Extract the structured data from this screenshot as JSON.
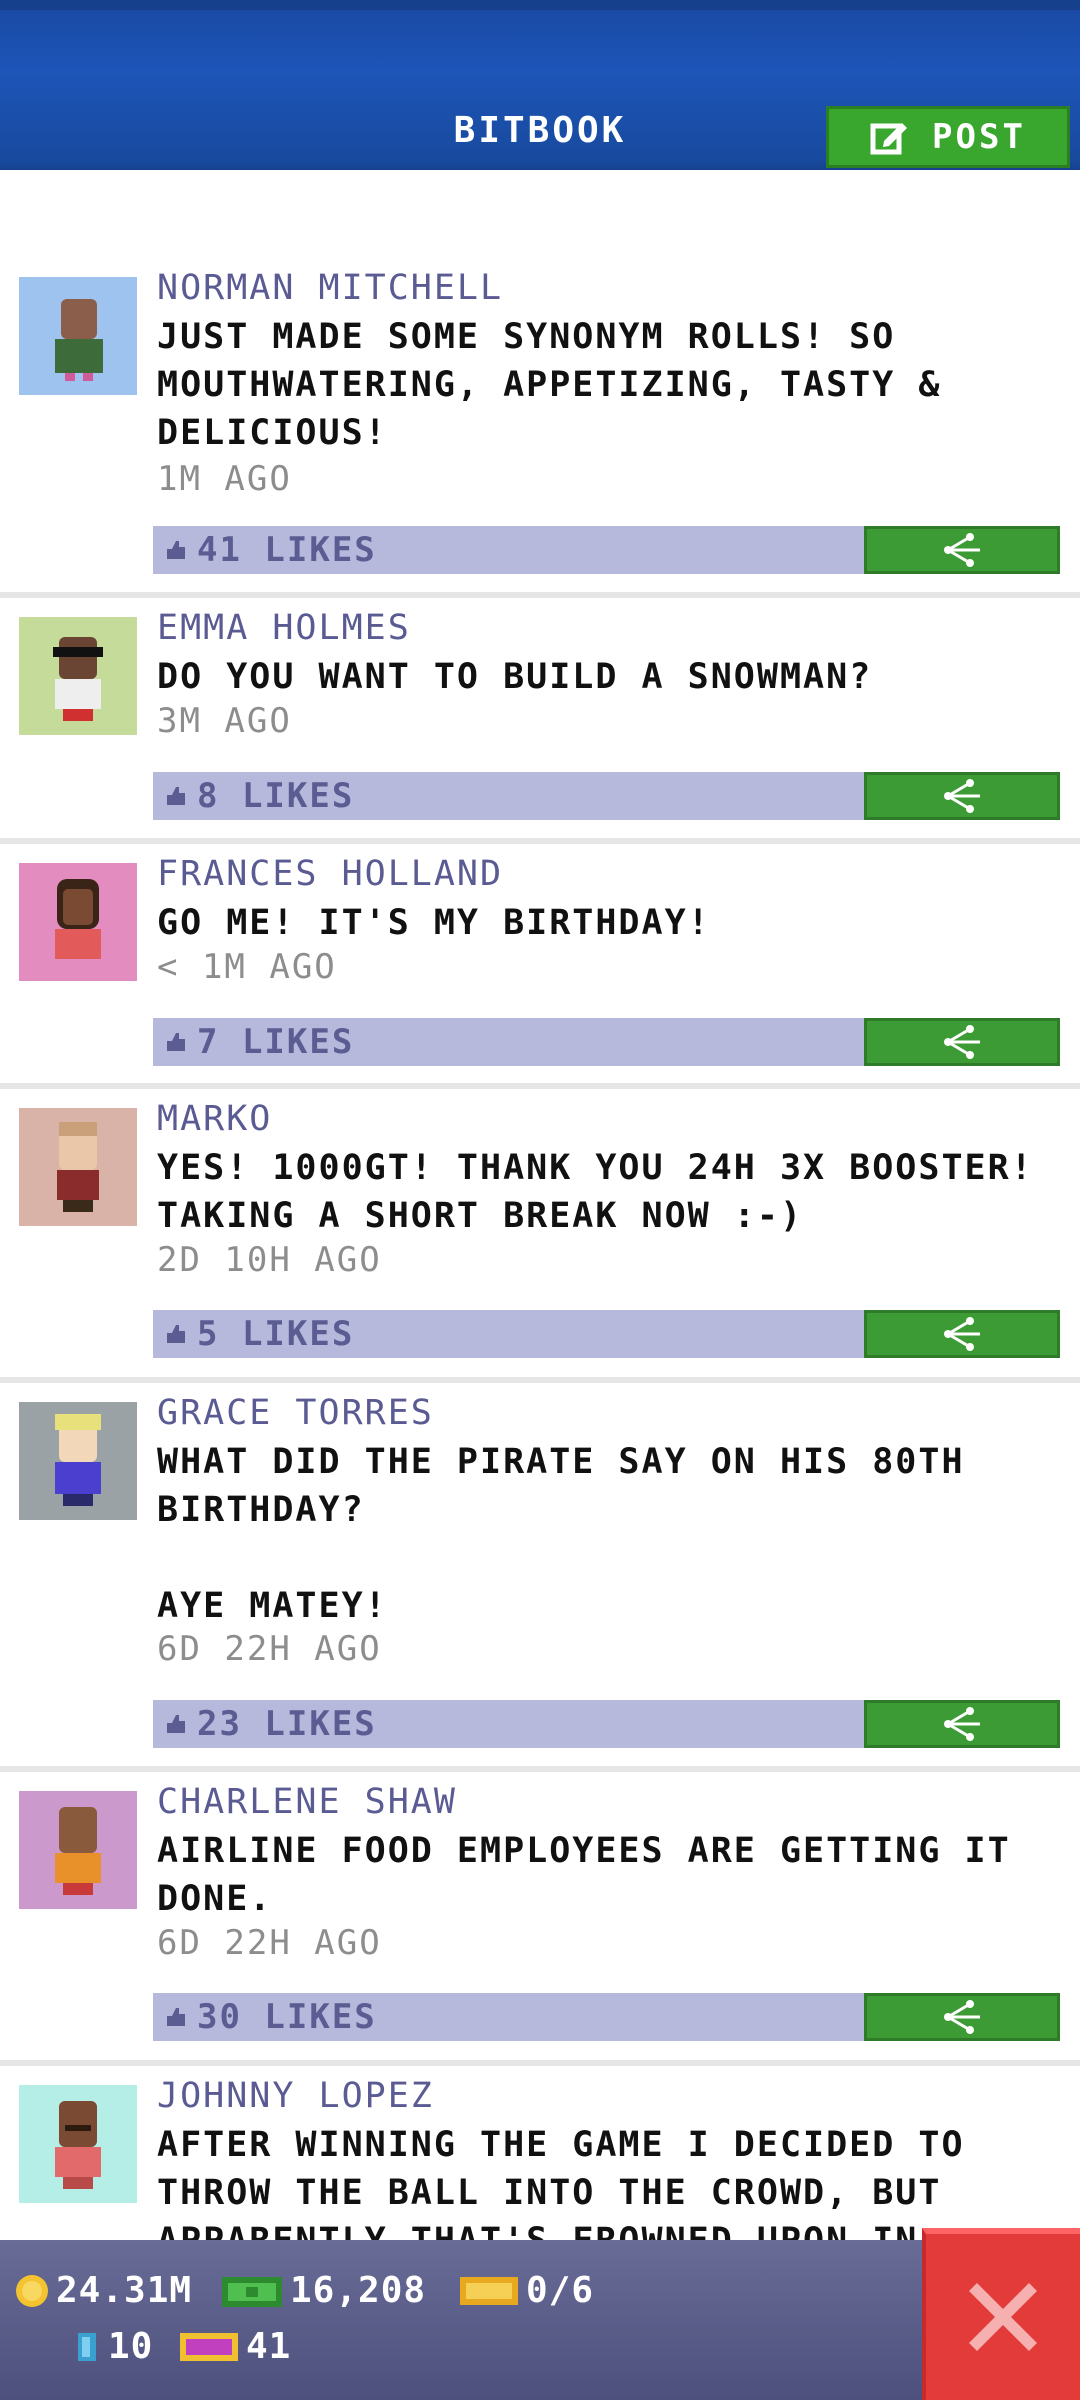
{
  "header": {
    "title": "BITBOOK",
    "post_label": "POST"
  },
  "posts": [
    {
      "author": "NORMAN MITCHELL",
      "message": "JUST MADE SOME SYNONYM ROLLS! SO\nMOUTHWATERING, APPETIZING, TASTY &\nDELICIOUS!",
      "time": "1M AGO",
      "likes": "41 LIKES",
      "avatar_bg": "#9ec3ee"
    },
    {
      "author": "EMMA HOLMES",
      "message": "DO YOU WANT TO BUILD A SNOWMAN?",
      "time": "3M AGO",
      "likes": "8 LIKES",
      "avatar_bg": "#c5db9a"
    },
    {
      "author": "FRANCES HOLLAND",
      "message": "GO ME! IT'S MY BIRTHDAY!",
      "time": "< 1M AGO",
      "likes": "7 LIKES",
      "avatar_bg": "#e38cc0"
    },
    {
      "author": "MARKO",
      "message": "YES! 1000GT! THANK YOU 24H 3X BOOSTER!\nTAKING A SHORT BREAK NOW :-)",
      "time": "2D 10H AGO",
      "likes": "5 LIKES",
      "avatar_bg": "#d9b3a8"
    },
    {
      "author": "GRACE TORRES",
      "message": "WHAT DID THE PIRATE SAY ON HIS 80TH\nBIRTHDAY?\n\nAYE MATEY!",
      "time": "6D 22H AGO",
      "likes": "23 LIKES",
      "avatar_bg": "#9aa2a6"
    },
    {
      "author": "CHARLENE SHAW",
      "message": "AIRLINE FOOD EMPLOYEES ARE GETTING IT\nDONE.",
      "time": "6D 22H AGO",
      "likes": "30 LIKES",
      "avatar_bg": "#cc99cc"
    },
    {
      "author": "JOHNNY LOPEZ",
      "message": "AFTER WINNING THE GAME I DECIDED TO\nTHROW THE BALL INTO THE CROWD, BUT\nAPPARENTLY THAT'S FROWNED UPON IN",
      "avatar_bg": "#b5eee6"
    }
  ],
  "status": {
    "coins": "24.31M",
    "bux": "16,208",
    "tickets": "0/6",
    "gems": "10",
    "vip": "41"
  },
  "colors": {
    "header_blue": "#1d55b8",
    "post_green": "#39a72e",
    "likes_bar": "#b6b8dc",
    "author_purple": "#5b5b94",
    "close_red": "#e33a3a"
  }
}
